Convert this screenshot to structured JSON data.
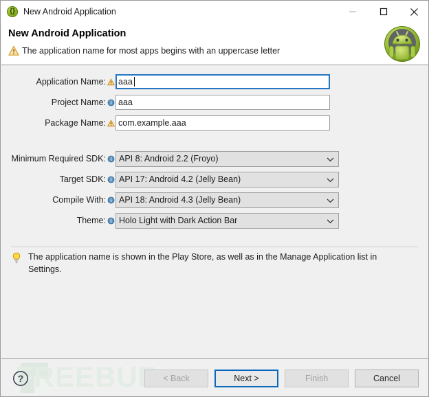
{
  "window": {
    "title": "New Android Application",
    "icon": "java-braces-icon",
    "controls": [
      {
        "name": "minimize",
        "label": "—",
        "enabled": false
      },
      {
        "name": "maximize",
        "label": "□",
        "enabled": true
      },
      {
        "name": "close",
        "label": "✕",
        "enabled": true
      }
    ]
  },
  "header": {
    "title": "New Android Application",
    "message": "The application name for most apps begins with an uppercase letter",
    "message_icon": "warning-triangle-icon",
    "mascot_icon": "android-mascot-icon"
  },
  "form": {
    "text_fields": [
      {
        "label": "Application Name:",
        "badge": "warning-triangle-icon",
        "value": "aaa",
        "placeholder": "",
        "focused": true
      },
      {
        "label": "Project Name:",
        "badge": "info-circle-icon",
        "value": "aaa",
        "placeholder": "",
        "focused": false
      },
      {
        "label": "Package Name:",
        "badge": "warning-triangle-icon",
        "value": "com.example.aaa",
        "placeholder": "",
        "focused": false
      }
    ],
    "dropdowns": [
      {
        "label": "Minimum Required SDK:",
        "badge": "info-circle-icon",
        "value": "API 8: Android 2.2 (Froyo)"
      },
      {
        "label": "Target SDK:",
        "badge": "info-circle-icon",
        "value": "API 17: Android 4.2 (Jelly Bean)"
      },
      {
        "label": "Compile With:",
        "badge": "info-circle-icon",
        "value": "API 18: Android 4.3 (Jelly Bean)"
      },
      {
        "label": "Theme:",
        "badge": "info-circle-icon",
        "value": "Holo Light with Dark Action Bar"
      }
    ]
  },
  "hint": {
    "icon": "lightbulb-icon",
    "text": "The application name is shown in the Play Store, as well as in the Manage Application list in Settings."
  },
  "footer": {
    "help_icon": "question-mark-icon",
    "watermark": "FREEBUF",
    "buttons": [
      {
        "name": "back",
        "label": "< Back",
        "enabled": false,
        "focused": false
      },
      {
        "name": "next",
        "label": "Next >",
        "enabled": true,
        "focused": true
      },
      {
        "name": "finish",
        "label": "Finish",
        "enabled": false,
        "focused": false
      },
      {
        "name": "cancel",
        "label": "Cancel",
        "enabled": true,
        "focused": false
      }
    ]
  },
  "colors": {
    "dialog_bg": "#f0f0f0",
    "titlebar_bg": "#ffffff",
    "focus_blue": "#0a68bc",
    "input_focus_border": "#2577c4",
    "warning_orange": "#e8a33d",
    "info_blue": "#3c7fb1",
    "android_green": "#a4c639",
    "watermark_gray": "#e4ece6",
    "disabled_text": "#a0a0a0"
  }
}
